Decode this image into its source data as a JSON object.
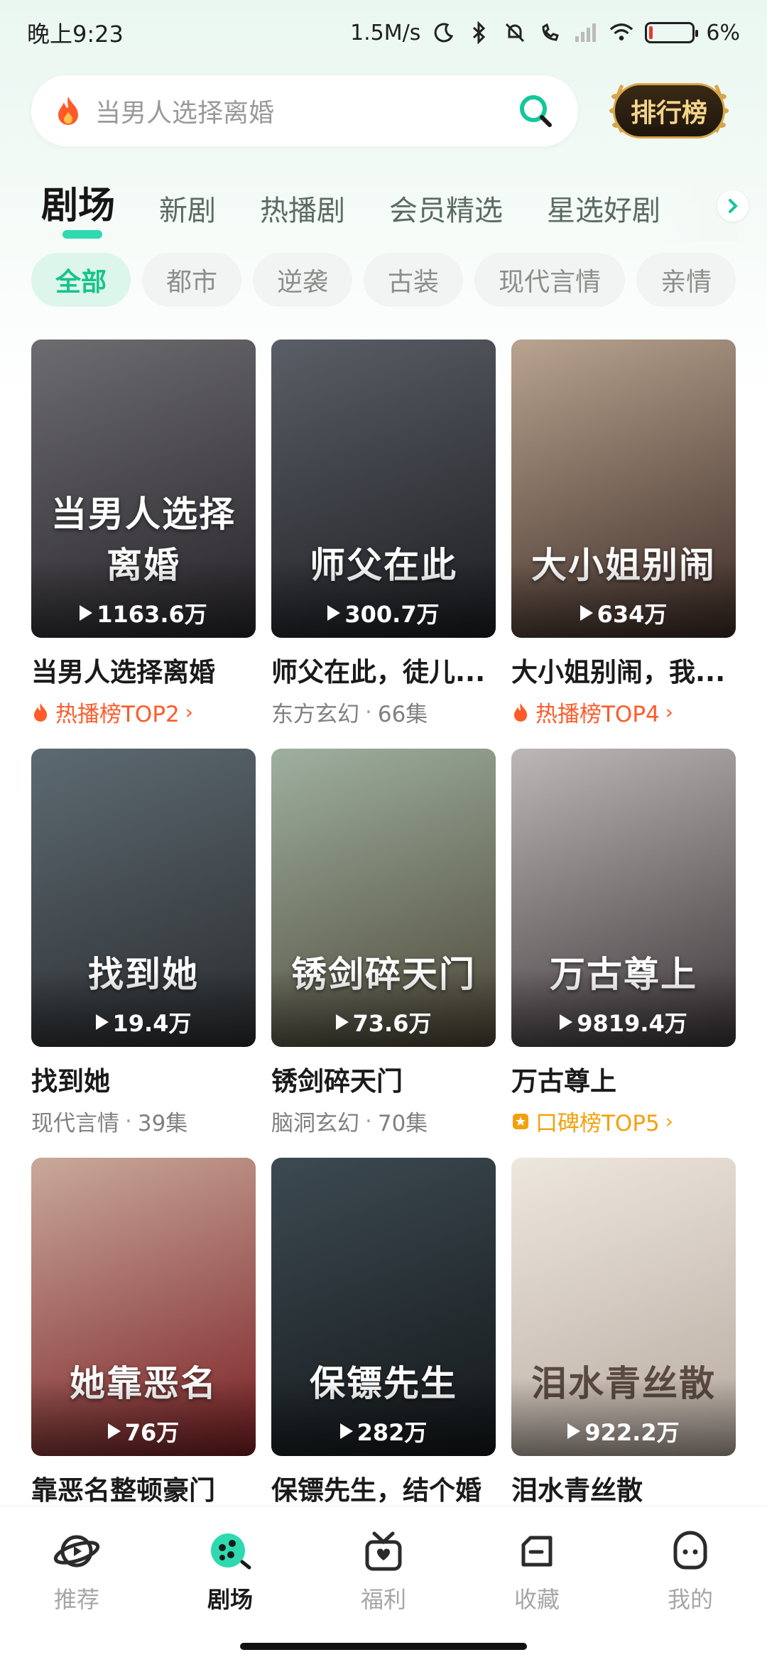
{
  "status_bar": {
    "time": "晚上9:23",
    "network_speed": "1.5M/s",
    "battery": "6%",
    "battery_level": 0.06
  },
  "search": {
    "placeholder": "当男人选择离婚"
  },
  "rank_button": {
    "label": "排行榜"
  },
  "tabs": [
    {
      "label": "剧场",
      "active": true
    },
    {
      "label": "新剧"
    },
    {
      "label": "热播剧"
    },
    {
      "label": "会员精选"
    },
    {
      "label": "星选好剧"
    }
  ],
  "chips": [
    {
      "label": "全部",
      "active": true
    },
    {
      "label": "都市"
    },
    {
      "label": "逆袭"
    },
    {
      "label": "古装"
    },
    {
      "label": "现代言情"
    },
    {
      "label": "亲情"
    }
  ],
  "cards": [
    {
      "title": "当男人选择离婚",
      "poster_text": "当男人选择离婚",
      "plays": "1163.6万",
      "meta_type": "hot",
      "rank_label": "热播榜TOP2",
      "colors": [
        "#6d6c71",
        "#262428"
      ]
    },
    {
      "title": "师父在此，徒儿...",
      "poster_text": "师父在此",
      "plays": "300.7万",
      "meta_type": "genre",
      "genre": "东方玄幻",
      "episodes": "66集",
      "colors": [
        "#5a5e66",
        "#1c1d21"
      ]
    },
    {
      "title": "大小姐别闹，我...",
      "poster_text": "大小姐别闹",
      "plays": "634万",
      "meta_type": "hot",
      "rank_label": "热播榜TOP4",
      "colors": [
        "#b8a48f",
        "#3c2a25"
      ]
    },
    {
      "title": "找到她",
      "poster_text": "找到她",
      "plays": "19.4万",
      "meta_type": "genre",
      "genre": "现代言情",
      "episodes": "39集",
      "colors": [
        "#5d6a72",
        "#2a2c2e"
      ]
    },
    {
      "title": "锈剑碎天门",
      "poster_text": "锈剑碎天门",
      "plays": "73.6万",
      "meta_type": "genre",
      "genre": "脑洞玄幻",
      "episodes": "70集",
      "colors": [
        "#9fb0a0",
        "#4c4636"
      ]
    },
    {
      "title": "万古尊上",
      "poster_text": "万古尊上",
      "plays": "9819.4万",
      "meta_type": "praise",
      "rank_label": "口碑榜TOP5",
      "colors": [
        "#bdb7b8",
        "#3b3537"
      ]
    },
    {
      "title": "靠恶名整顿豪门",
      "poster_text": "她靠恶名",
      "plays": "76万",
      "meta_type": "none",
      "colors": [
        "#c9a99a",
        "#7a1f23"
      ]
    },
    {
      "title": "保镖先生，结个婚",
      "poster_text": "保镖先生",
      "plays": "282万",
      "meta_type": "none",
      "colors": [
        "#3d4a52",
        "#131719"
      ]
    },
    {
      "title": "泪水青丝散",
      "poster_text": "泪水青丝散",
      "plays": "922.2万",
      "meta_type": "none",
      "colors": [
        "#eee7de",
        "#b7aaa0"
      ]
    }
  ],
  "bottom_nav": [
    {
      "label": "推荐",
      "icon": "planet-play-icon"
    },
    {
      "label": "剧场",
      "icon": "theater-icon",
      "active": true
    },
    {
      "label": "福利",
      "icon": "gift-icon"
    },
    {
      "label": "收藏",
      "icon": "folder-icon"
    },
    {
      "label": "我的",
      "icon": "profile-icon"
    }
  ],
  "accent": {
    "green": "#17c38a",
    "tab_indicator": "#2fd9b0",
    "hot": "#ff5a2a",
    "praise": "#f2a10d"
  }
}
